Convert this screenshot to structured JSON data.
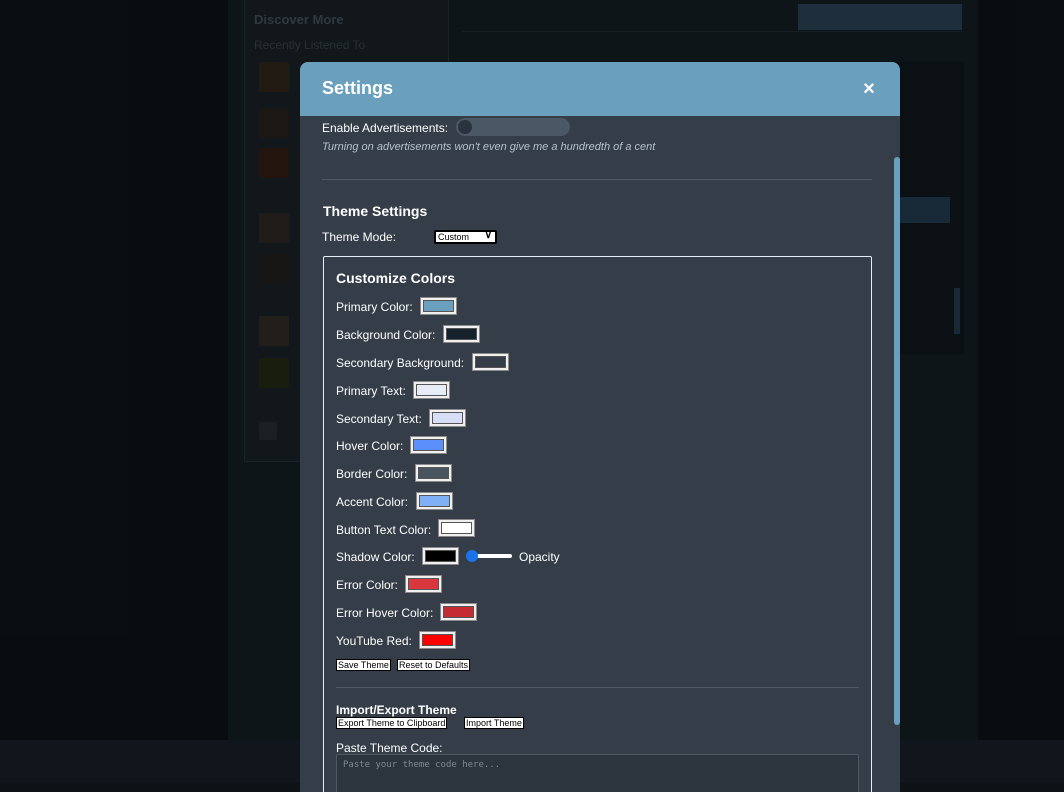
{
  "modal": {
    "title": "Settings",
    "close_symbol": "×"
  },
  "ads": {
    "label": "Enable Advertisements:",
    "enabled": false,
    "note": "Turning on advertisements won't even give me a hundredth of a cent"
  },
  "theme": {
    "section_title": "Theme Settings",
    "mode_label": "Theme Mode:",
    "mode_value": "Custom",
    "customize": {
      "title": "Customize Colors",
      "rows": [
        {
          "label": "Primary Color:",
          "color": "#6a9fbd"
        },
        {
          "label": "Background Color:",
          "color": "#16222b"
        },
        {
          "label": "Secondary Background:",
          "color": "#343d48"
        },
        {
          "label": "Primary Text:",
          "color": "#e6edf7"
        },
        {
          "label": "Secondary Text:",
          "color": "#d6def8"
        },
        {
          "label": "Hover Color:",
          "color": "#5b8ff9"
        },
        {
          "label": "Border Color:",
          "color": "#4a545e"
        },
        {
          "label": "Accent Color:",
          "color": "#7fb0f5"
        },
        {
          "label": "Button Text Color:",
          "color": "#ffffff"
        },
        {
          "label": "Shadow Color:",
          "color": "#000000"
        },
        {
          "label": "Error Color:",
          "color": "#d9363e"
        },
        {
          "label": "Error Hover Color:",
          "color": "#c42b33"
        },
        {
          "label": "YouTube Red:",
          "color": "#ff0000"
        }
      ],
      "opacity_label": "Opacity",
      "opacity_value": 0.05,
      "save_button": "Save Theme",
      "reset_button": "Reset to Defaults"
    },
    "import_export": {
      "title": "Import/Export Theme",
      "export_button": "Export Theme to Clipboard",
      "import_button": "Import Theme",
      "paste_label": "Paste Theme Code:",
      "paste_placeholder": "Paste your theme code here..."
    }
  },
  "background_app": {
    "sidebar_title": "Discover More",
    "sidebar_subtitle": "Recently Listened To"
  },
  "icons": {
    "close": "close-icon",
    "dropdown": "chevron-down-icon"
  }
}
